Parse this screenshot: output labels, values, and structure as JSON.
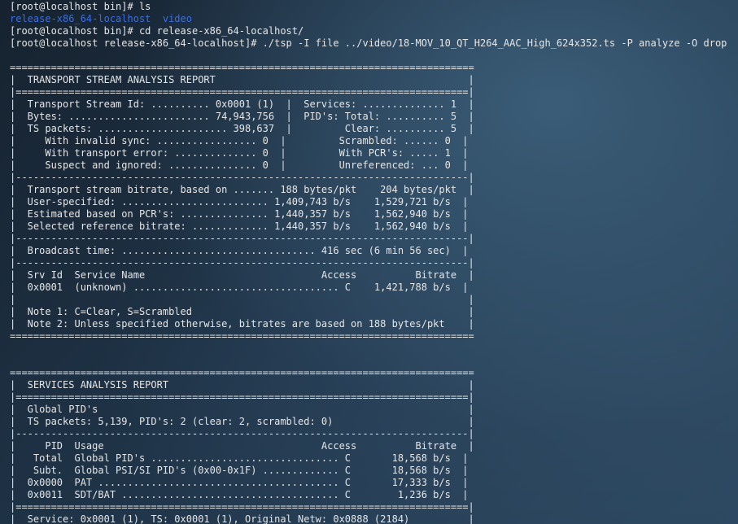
{
  "terminal": {
    "lines": [
      {
        "text": "[root@localhost bin]# ls",
        "color": "default"
      },
      {
        "text": "release-x86_64-localhost  video",
        "color": "blue"
      },
      {
        "text": "[root@localhost bin]# cd release-x86_64-localhost/",
        "color": "default"
      },
      {
        "text": "[root@localhost release-x86_64-localhost]# ./tsp -I file ../video/18-MOV_10_QT_H264_AAC_High_624x352.ts -P analyze -O drop",
        "color": "default"
      },
      {
        "text": "",
        "color": "default"
      },
      {
        "text": "===============================================================================",
        "color": "default"
      },
      {
        "text": "|  TRANSPORT STREAM ANALYSIS REPORT                                           |",
        "color": "default"
      },
      {
        "text": "|=============================================================================|",
        "color": "default"
      },
      {
        "text": "|  Transport Stream Id: .......... 0x0001 (1)  |  Services: .............. 1  |",
        "color": "default"
      },
      {
        "text": "|  Bytes: ........................ 74,943,756  |  PID's: Total: .......... 5  |",
        "color": "default"
      },
      {
        "text": "|  TS packets: ...................... 398,637  |         Clear: .......... 5  |",
        "color": "default"
      },
      {
        "text": "|     With invalid sync: ................. 0  |         Scrambled: ...... 0  |",
        "color": "default"
      },
      {
        "text": "|     With transport error: .............. 0  |         With PCR's: ..... 1  |",
        "color": "default"
      },
      {
        "text": "|     Suspect and ignored: ............... 0  |         Unreferenced: ... 0  |",
        "color": "default"
      },
      {
        "text": "|-----------------------------------------------------------------------------|",
        "color": "default"
      },
      {
        "text": "|  Transport stream bitrate, based on ....... 188 bytes/pkt    204 bytes/pkt  |",
        "color": "default"
      },
      {
        "text": "|  User-specified: ......................... 1,409,743 b/s    1,529,721 b/s  |",
        "color": "default"
      },
      {
        "text": "|  Estimated based on PCR's: ............... 1,440,357 b/s    1,562,940 b/s  |",
        "color": "default"
      },
      {
        "text": "|  Selected reference bitrate: ............. 1,440,357 b/s    1,562,940 b/s  |",
        "color": "default"
      },
      {
        "text": "|-----------------------------------------------------------------------------|",
        "color": "default"
      },
      {
        "text": "|  Broadcast time: ................................. 416 sec (6 min 56 sec)  |",
        "color": "default"
      },
      {
        "text": "|-----------------------------------------------------------------------------|",
        "color": "default"
      },
      {
        "text": "|  Srv Id  Service Name                              Access          Bitrate  |",
        "color": "default"
      },
      {
        "text": "|  0x0001  (unknown) ................................... C    1,421,788 b/s  |",
        "color": "default"
      },
      {
        "text": "|                                                                             |",
        "color": "default"
      },
      {
        "text": "|  Note 1: C=Clear, S=Scrambled                                               |",
        "color": "default"
      },
      {
        "text": "|  Note 2: Unless specified otherwise, bitrates are based on 188 bytes/pkt    |",
        "color": "default"
      },
      {
        "text": "===============================================================================",
        "color": "default"
      },
      {
        "text": "",
        "color": "default"
      },
      {
        "text": "",
        "color": "default"
      },
      {
        "text": "===============================================================================",
        "color": "default"
      },
      {
        "text": "|  SERVICES ANALYSIS REPORT                                                   |",
        "color": "default"
      },
      {
        "text": "|=============================================================================|",
        "color": "default"
      },
      {
        "text": "|  Global PID's                                                               |",
        "color": "default"
      },
      {
        "text": "|  TS packets: 5,139, PID's: 2 (clear: 2, scrambled: 0)                       |",
        "color": "default"
      },
      {
        "text": "|-----------------------------------------------------------------------------|",
        "color": "default"
      },
      {
        "text": "|     PID  Usage                                     Access          Bitrate  |",
        "color": "default"
      },
      {
        "text": "|   Total  Global PID's ................................ C       18,568 b/s  |",
        "color": "default"
      },
      {
        "text": "|   Subt.  Global PSI/SI PID's (0x00-0x1F) ............. C       18,568 b/s  |",
        "color": "default"
      },
      {
        "text": "|  0x0000  PAT ......................................... C       17,333 b/s  |",
        "color": "default"
      },
      {
        "text": "|  0x0011  SDT/BAT ..................................... C        1,236 b/s  |",
        "color": "default"
      },
      {
        "text": "|=============================================================================|",
        "color": "default"
      },
      {
        "text": "|  Service: 0x0001 (1), TS: 0x0001 (1), Original Netw: 0x0888 (2184)          |",
        "color": "default"
      }
    ]
  },
  "colors": {
    "default_text": "#e6e6e6",
    "blue_text": "#3b6fe0"
  }
}
